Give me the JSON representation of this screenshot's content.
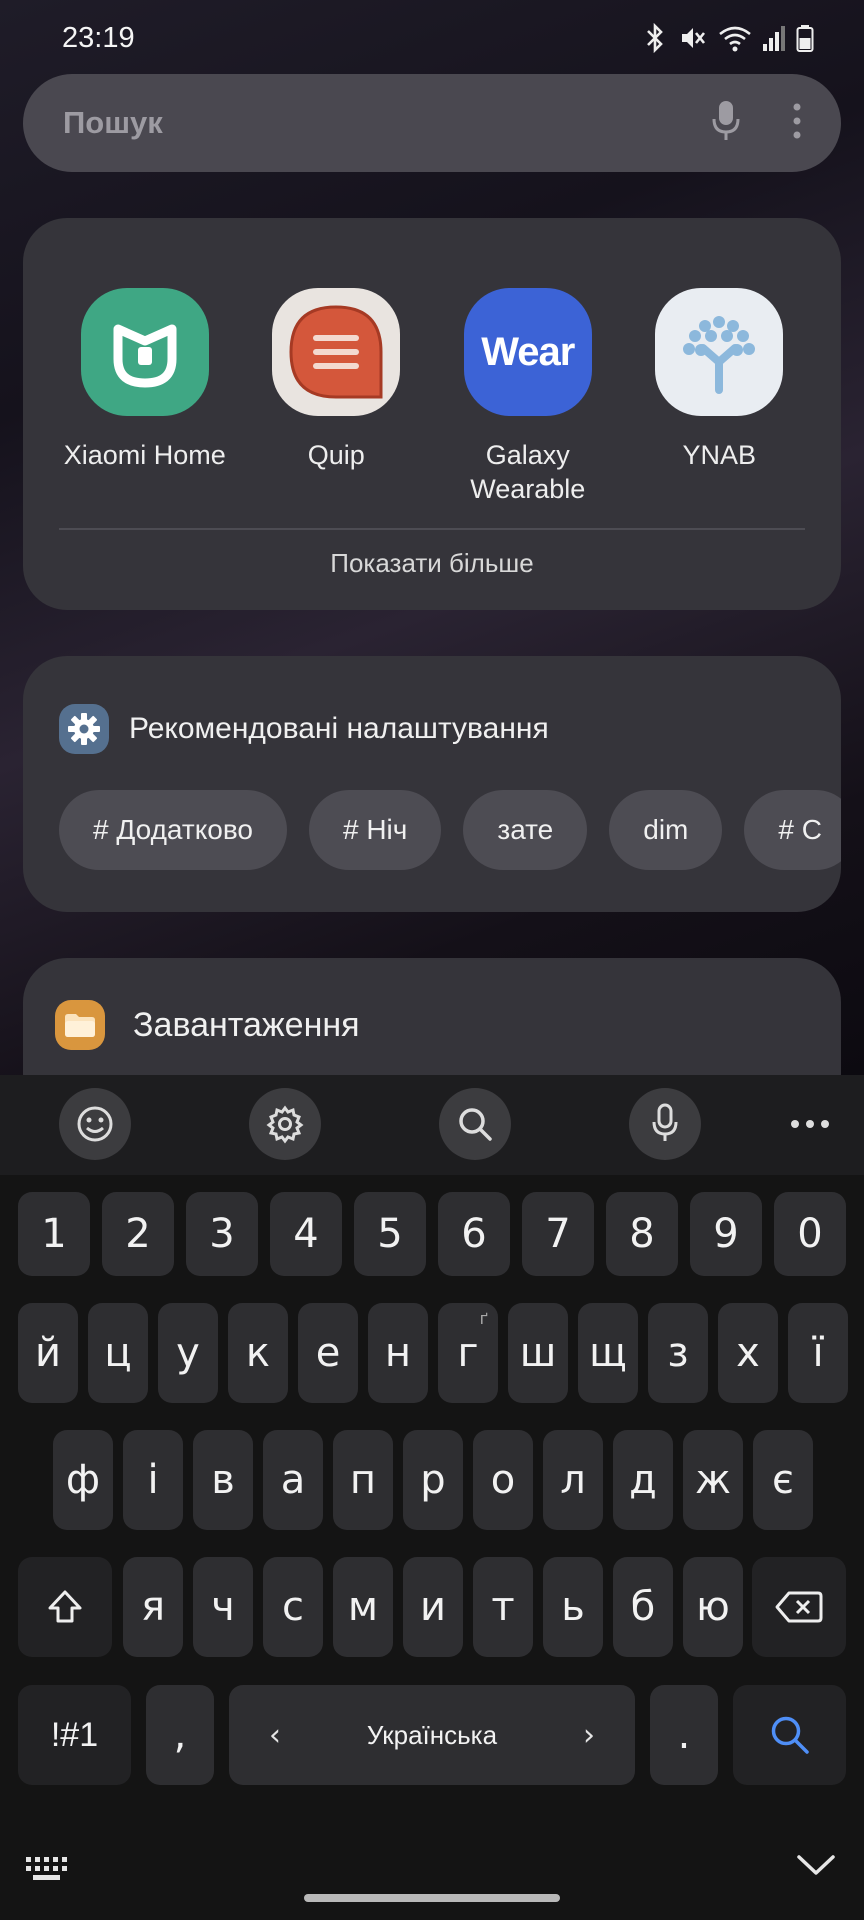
{
  "status_bar": {
    "time": "23:19",
    "icons": [
      "bluetooth-icon",
      "mute-icon",
      "wifi-icon",
      "signal-icon",
      "battery-icon"
    ]
  },
  "search": {
    "placeholder": "Пошук",
    "icons": [
      "mic-icon",
      "more-vert-icon"
    ]
  },
  "apps": {
    "items": [
      {
        "label": "Xiaomi Home",
        "icon": "xiaomi-home-icon",
        "color": "#3fa784"
      },
      {
        "label": "Quip",
        "icon": "quip-icon",
        "color": "#d4573b"
      },
      {
        "label": "Galaxy Wearable",
        "icon": "galaxy-wearable-icon",
        "icon_text": "Wear",
        "color": "#3c63d6"
      },
      {
        "label": "YNAB",
        "icon": "ynab-icon",
        "color": "#e9edf2"
      }
    ],
    "show_more": "Показати більше"
  },
  "recommended": {
    "title": "Рекомендовані налаштування",
    "icon": "settings-gear-icon",
    "chips": [
      "# Додатково",
      "# Ніч",
      "зате",
      "dim",
      "# С"
    ]
  },
  "downloads": {
    "title": "Завантаження",
    "icon": "folder-icon"
  },
  "keyboard": {
    "toolbar": [
      "emoji-icon",
      "settings-icon",
      "search-icon",
      "mic-icon",
      "more-icon"
    ],
    "row_numbers": [
      "1",
      "2",
      "3",
      "4",
      "5",
      "6",
      "7",
      "8",
      "9",
      "0"
    ],
    "row1": [
      "й",
      "ц",
      "у",
      "к",
      "е",
      "н",
      "г",
      "ш",
      "щ",
      "з",
      "х",
      "ї"
    ],
    "row1_alt": {
      "г": "ґ"
    },
    "row2": [
      "ф",
      "і",
      "в",
      "а",
      "п",
      "р",
      "о",
      "л",
      "д",
      "ж",
      "є"
    ],
    "row3": [
      "я",
      "ч",
      "с",
      "м",
      "и",
      "т",
      "ь",
      "б",
      "ю"
    ],
    "symbols_label": "!#1",
    "comma_label": ",",
    "space_label": "Українська",
    "period_label": "."
  },
  "nav": {
    "left_icon": "keyboard-switch-icon",
    "right_icon": "hide-keyboard-icon"
  }
}
